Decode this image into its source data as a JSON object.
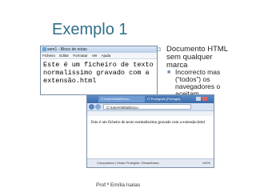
{
  "slide": {
    "title": "Exemplo 1",
    "footer": "Prof.ª Emília Isaías"
  },
  "notepad": {
    "window_title": "sem1 - Bloco de notas",
    "menu": [
      "Ficheiro",
      "Editar",
      "Formatar",
      "Ver",
      "Ajuda"
    ],
    "content": "Este é um ficheiro de texto\nnormalíssimo gravado com a\nextensão.html"
  },
  "bullets": {
    "main": "Documento HTML\nsem qualquer\nmarca",
    "sub": "Incorrecto mas\n(“todos”) os\nnavegadores o\naceitam."
  },
  "browser": {
    "tabs": [
      "C:\\Users\\Milai\\Docu...",
      "IT Português (Portugal)"
    ],
    "address": "C:\\Users\\Milai\\Docu",
    "page_text": "Este é um ficheiro de texto normalíssimo gravado com a extensão.html",
    "status": "Computador | Modo Protegido: Desactivado",
    "zoom": "100%"
  },
  "colors": {
    "title": "#2f6f8a",
    "bullet_marker": "#6a8fb0"
  }
}
